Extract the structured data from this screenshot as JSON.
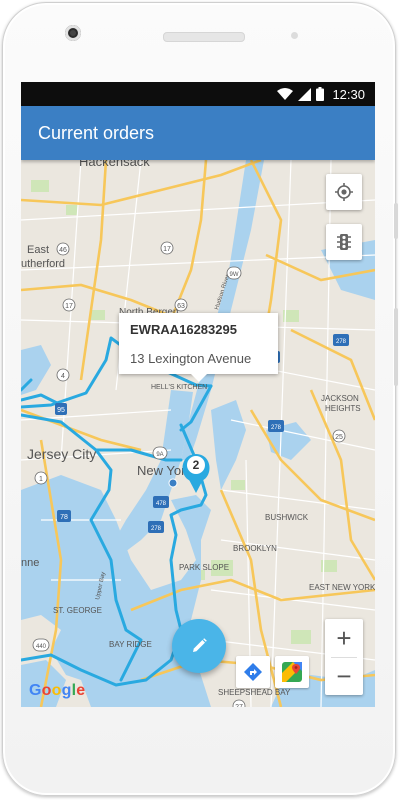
{
  "status_bar": {
    "time": "12:30"
  },
  "app_bar": {
    "title": "Current orders"
  },
  "map": {
    "labels": {
      "hackensack": "Hackensack",
      "east_rutherford_1": "East",
      "east_rutherford_2": "utherford",
      "north_bergen": "North Bergen",
      "hells_kitchen": "HELL'S KITCHEN",
      "jersey_city": "Jersey City",
      "new_york": "New York",
      "jackson_heights_1": "JACKSON",
      "jackson_heights_2": "HEIGHTS",
      "bushwick": "BUSHWICK",
      "brooklyn": "BROOKLYN",
      "park_slope": "PARK SLOPE",
      "east_new_york": "EAST NEW YORK",
      "st_george": "ST. GEORGE",
      "bay_ridge": "BAY RIDGE",
      "sheepshead_bay": "SHEEPSHEAD BAY",
      "upper_bay": "Upper Bay",
      "hudson_river": "Hudson River",
      "lower_edge": "nne"
    },
    "route_shields": [
      "46",
      "17",
      "4",
      "9W",
      "3",
      "63",
      "17",
      "87",
      "95",
      "9A",
      "278",
      "25",
      "278",
      "3",
      "1",
      "78",
      "478",
      "278",
      "27",
      "440",
      "1"
    ],
    "marker": {
      "number": "2"
    },
    "popup": {
      "order_id": "EWRAA16283295",
      "address": "13 Lexington Avenue"
    },
    "google_logo": "Google",
    "zoom_in": "+",
    "zoom_out": "−"
  },
  "icons": {
    "my_location": "my-location-icon",
    "traffic": "traffic-light-icon",
    "edit": "pencil-icon",
    "directions": "directions-icon",
    "google_maps": "google-maps-icon"
  },
  "colors": {
    "app_bar": "#3b7fc4",
    "route": "#29a9e0",
    "fab": "#4ab5e8",
    "water": "#aad2ee",
    "land": "#ebe7df",
    "highway": "#f7c75a"
  }
}
